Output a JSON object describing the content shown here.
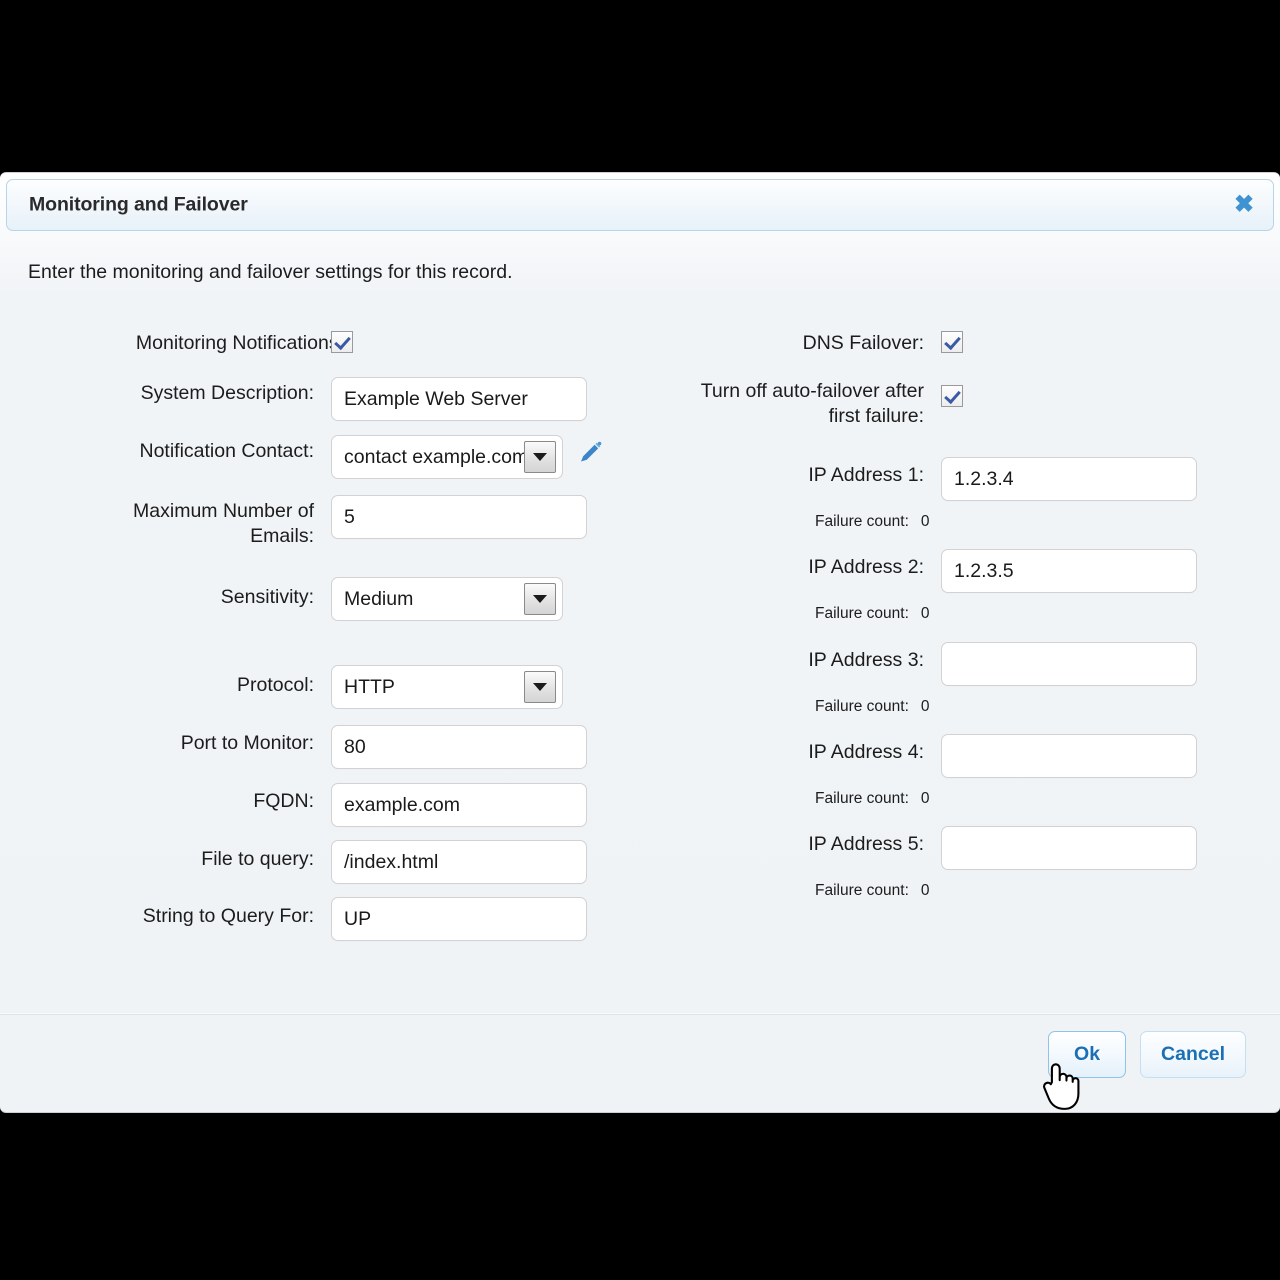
{
  "dialog": {
    "title": "Monitoring and Failover",
    "close_icon": "close-icon",
    "intro": "Enter the monitoring and failover settings for this record."
  },
  "left_column": {
    "monitoring_notifications": {
      "label": "Monitoring Notifications:",
      "checked": true
    },
    "system_description": {
      "label": "System Description:",
      "value": "Example Web Server"
    },
    "notification_contact": {
      "label": "Notification Contact:",
      "value": "contact example.com",
      "edit_icon": "pencil-icon"
    },
    "maximum_number_of_emails": {
      "label": "Maximum Number of\nEmails:",
      "value": "5"
    },
    "sensitivity": {
      "label": "Sensitivity:",
      "value": "Medium"
    },
    "protocol": {
      "label": "Protocol:",
      "value": "HTTP"
    },
    "port_to_monitor": {
      "label": "Port to Monitor:",
      "value": "80"
    },
    "fqdn": {
      "label": "FQDN:",
      "value": "example.com"
    },
    "file_to_query": {
      "label": "File to query:",
      "value": "/index.html"
    },
    "string_to_query_for": {
      "label": "String to Query For:",
      "value": "UP"
    }
  },
  "right_column": {
    "dns_failover": {
      "label": "DNS Failover:",
      "checked": true
    },
    "turn_off_auto_failover": {
      "label": "Turn off auto-failover after\nfirst failure:",
      "checked": true
    },
    "failure_count_label": "Failure count:",
    "ip_addresses": [
      {
        "label": "IP Address 1:",
        "value": "1.2.3.4",
        "failure_count": "0"
      },
      {
        "label": "IP Address 2:",
        "value": "1.2.3.5",
        "failure_count": "0"
      },
      {
        "label": "IP Address 3:",
        "value": "",
        "failure_count": "0"
      },
      {
        "label": "IP Address 4:",
        "value": "",
        "failure_count": "0"
      },
      {
        "label": "IP Address 5:",
        "value": "",
        "failure_count": "0"
      }
    ]
  },
  "footer": {
    "ok_label": "Ok",
    "cancel_label": "Cancel"
  },
  "colors": {
    "accent_blue": "#1a6fb5",
    "title_border": "#b7d4e8",
    "body_bg": "#f0f3f6",
    "close_blue": "#3f93d0"
  }
}
